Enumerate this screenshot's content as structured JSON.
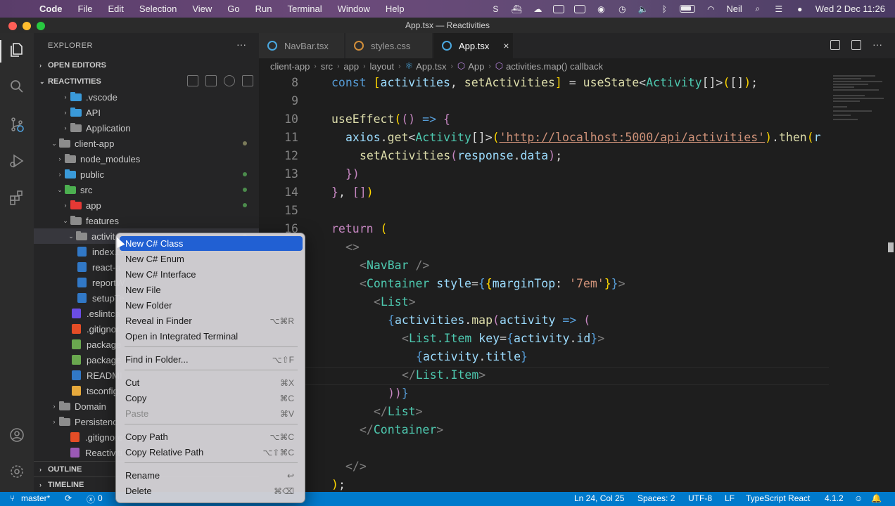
{
  "menubar": {
    "app_name": "Code",
    "items": [
      "File",
      "Edit",
      "Selection",
      "View",
      "Go",
      "Run",
      "Terminal",
      "Window",
      "Help"
    ],
    "user": "Neil",
    "clock": "Wed 2 Dec  11:26"
  },
  "window": {
    "title": "App.tsx — Reactivities"
  },
  "explorer": {
    "header": "EXPLORER",
    "more": "···",
    "open_editors": "OPEN EDITORS",
    "project": "REACTIVITIES",
    "outline": "OUTLINE",
    "timeline": "TIMELINE",
    "tree": [
      {
        "label": ".vscode",
        "twisty": "›",
        "icon": "folder-vscode-icon"
      },
      {
        "label": "API",
        "twisty": "›",
        "icon": "folder-icon"
      },
      {
        "label": "Application",
        "twisty": "›",
        "icon": "folder-icon"
      },
      {
        "label": "client-app",
        "twisty": "⌄",
        "icon": "folder-open-icon"
      },
      {
        "label": "node_modules",
        "twisty": "›",
        "icon": "folder-node-icon"
      },
      {
        "label": "public",
        "twisty": "›",
        "icon": "folder-public-icon"
      },
      {
        "label": "src",
        "twisty": "⌄",
        "icon": "folder-src-icon"
      },
      {
        "label": "app",
        "twisty": "›",
        "icon": "folder-app-icon"
      },
      {
        "label": "features",
        "twisty": "⌄",
        "icon": "folder-icon"
      },
      {
        "label": "activit",
        "twisty": "⌄",
        "icon": "folder-open-icon"
      },
      {
        "label": "index.ts",
        "twisty": "",
        "icon": "ts-file-icon"
      },
      {
        "label": "react-a",
        "twisty": "",
        "icon": "ts-file-icon"
      },
      {
        "label": "reportW",
        "twisty": "",
        "icon": "ts-file-icon"
      },
      {
        "label": "setupTe",
        "twisty": "",
        "icon": "ts-file-icon"
      },
      {
        "label": ".eslintca",
        "twisty": "",
        "icon": "eslint-file-icon"
      },
      {
        "label": ".gitignor",
        "twisty": "",
        "icon": "git-file-icon"
      },
      {
        "label": "package",
        "twisty": "",
        "icon": "npm-file-icon"
      },
      {
        "label": "package",
        "twisty": "",
        "icon": "npm-file-icon"
      },
      {
        "label": "READMI",
        "twisty": "",
        "icon": "info-file-icon"
      },
      {
        "label": "tsconfig.",
        "twisty": "",
        "icon": "json-file-icon"
      },
      {
        "label": "Domain",
        "twisty": "›",
        "icon": "folder-icon"
      },
      {
        "label": "Persistenc",
        "twisty": "›",
        "icon": "folder-icon"
      },
      {
        "label": ".gitignore",
        "twisty": "",
        "icon": "git-file-icon"
      },
      {
        "label": "Reactiviti",
        "twisty": "",
        "icon": "sln-file-icon"
      }
    ]
  },
  "tabs": [
    {
      "label": "NavBar.tsx",
      "active": false
    },
    {
      "label": "styles.css",
      "active": false
    },
    {
      "label": "App.tsx",
      "active": true,
      "close": "×"
    }
  ],
  "breadcrumb": [
    "client-app",
    "src",
    "app",
    "layout",
    "App.tsx",
    "App",
    "activities.map() callback"
  ],
  "editor": {
    "line_numbers": [
      "8",
      "9",
      "10",
      "11",
      "12",
      "13",
      "14",
      "15",
      "16"
    ]
  },
  "context_menu": {
    "items": [
      {
        "label": "New C# Class",
        "shortcut": ""
      },
      {
        "label": "New C# Enum",
        "shortcut": ""
      },
      {
        "label": "New C# Interface",
        "shortcut": ""
      },
      {
        "label": "New File",
        "shortcut": ""
      },
      {
        "label": "New Folder",
        "shortcut": ""
      },
      {
        "label": "Reveal in Finder",
        "shortcut": "⌥⌘R"
      },
      {
        "label": "Open in Integrated Terminal",
        "shortcut": ""
      },
      {
        "label": "Find in Folder...",
        "shortcut": "⌥⇧F"
      },
      {
        "label": "Cut",
        "shortcut": "⌘X"
      },
      {
        "label": "Copy",
        "shortcut": "⌘C"
      },
      {
        "label": "Paste",
        "shortcut": "⌘V"
      },
      {
        "label": "Copy Path",
        "shortcut": "⌥⌘C"
      },
      {
        "label": "Copy Relative Path",
        "shortcut": "⌥⇧⌘C"
      },
      {
        "label": "Rename",
        "shortcut": "↩"
      },
      {
        "label": "Delete",
        "shortcut": "⌘⌫"
      }
    ]
  },
  "statusbar": {
    "branch": "master*",
    "errors": "0",
    "position": "Ln 24, Col 25",
    "spaces": "Spaces: 2",
    "encoding": "UTF-8",
    "eol": "LF",
    "language": "TypeScript React",
    "version": "4.1.2"
  },
  "colors": {
    "accent": "#007acc",
    "menu_highlight": "#2160d3",
    "editor_bg": "#1e1e1e",
    "sidebar_bg": "#252526"
  }
}
